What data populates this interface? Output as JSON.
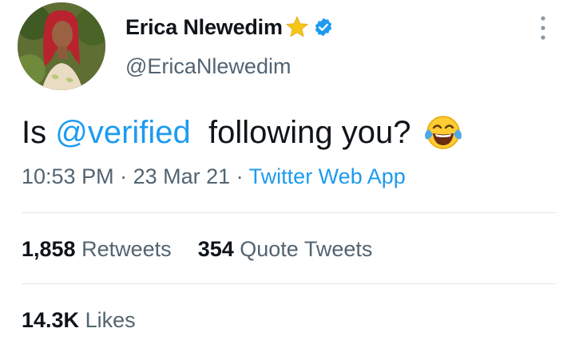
{
  "user": {
    "display_name": "Erica Nlewedim",
    "handle": "@EricaNlewedim",
    "badges": [
      "star-icon",
      "verified-badge-icon"
    ]
  },
  "tweet": {
    "text_prefix": "Is ",
    "mention": "@verified",
    "text_suffix": "  following you?",
    "emoji": "face-with-tears-of-joy-icon"
  },
  "meta": {
    "time": "10:53 PM",
    "sep1": " · ",
    "date": "23 Mar 21",
    "sep2": " · ",
    "source": "Twitter Web App"
  },
  "stats": {
    "retweets_count": "1,858",
    "retweets_label": "Retweets",
    "quotes_count": "354",
    "quotes_label": "Quote Tweets",
    "likes_count": "14.3K",
    "likes_label": "Likes"
  },
  "colors": {
    "accent": "#1d9bf0",
    "text": "#0f1419",
    "muted": "#536471",
    "star": "#f5c518",
    "divider": "#e2e6e9"
  }
}
